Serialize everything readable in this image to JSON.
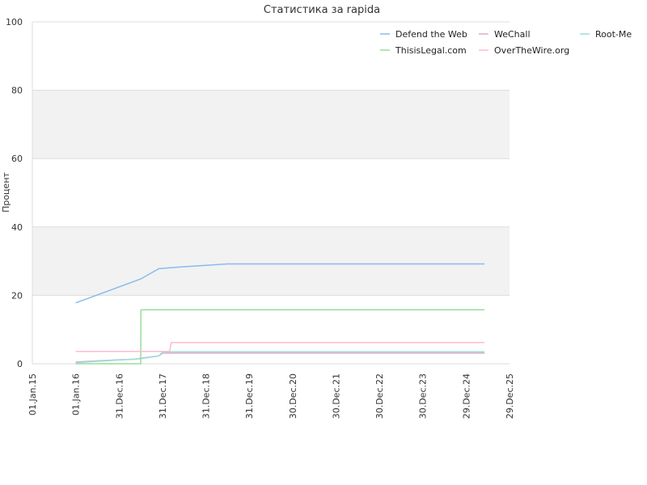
{
  "chart_data": {
    "type": "line",
    "title": "Статистика за rapida",
    "xlabel": "",
    "ylabel": "Процент",
    "ylim": [
      0,
      100
    ],
    "yticks": [
      0,
      20,
      40,
      60,
      80,
      100
    ],
    "xlim": [
      "2015-01-01",
      "2025-12-29"
    ],
    "xticks": [
      {
        "date": "2015-01-01",
        "label": "01.Jan.15"
      },
      {
        "date": "2016-01-01",
        "label": "01.Jan.16"
      },
      {
        "date": "2016-12-31",
        "label": "31.Dec.16"
      },
      {
        "date": "2017-12-31",
        "label": "31.Dec.17"
      },
      {
        "date": "2018-12-31",
        "label": "31.Dec.18"
      },
      {
        "date": "2019-12-31",
        "label": "31.Dec.19"
      },
      {
        "date": "2020-12-30",
        "label": "30.Dec.20"
      },
      {
        "date": "2021-12-30",
        "label": "30.Dec.21"
      },
      {
        "date": "2022-12-30",
        "label": "30.Dec.22"
      },
      {
        "date": "2023-12-30",
        "label": "30.Dec.23"
      },
      {
        "date": "2024-12-29",
        "label": "29.Dec.24"
      },
      {
        "date": "2025-12-29",
        "label": "29.Dec.25"
      }
    ],
    "grid": true,
    "legend_position": "top-right",
    "series": [
      {
        "name": "Defend the Web",
        "color": "#88bbee",
        "points": [
          [
            "2016-01-01",
            17.8
          ],
          [
            "2017-07-01",
            24.8
          ],
          [
            "2017-12-01",
            27.8
          ],
          [
            "2018-06-01",
            28.3
          ],
          [
            "2019-01-01",
            28.8
          ],
          [
            "2019-07-01",
            29.2
          ],
          [
            "2025-06-01",
            29.2
          ]
        ]
      },
      {
        "name": "WeChall",
        "color": "#ddaacc",
        "points": [
          [
            "2016-01-01",
            0.5
          ],
          [
            "2016-06-01",
            0.8
          ],
          [
            "2016-12-01",
            1.1
          ],
          [
            "2017-05-01",
            1.3
          ],
          [
            "2017-07-01",
            1.6
          ],
          [
            "2017-12-01",
            2.3
          ],
          [
            "2018-01-01",
            3.1
          ],
          [
            "2025-06-01",
            3.1
          ]
        ]
      },
      {
        "name": "Root-Me",
        "color": "#99dddd",
        "points": [
          [
            "2016-01-01",
            0.3
          ],
          [
            "2017-07-01",
            1.5
          ],
          [
            "2017-12-01",
            2.3
          ],
          [
            "2018-01-01",
            3.5
          ],
          [
            "2025-06-01",
            3.5
          ]
        ]
      },
      {
        "name": "ThisisLegal.com",
        "color": "#99dd99",
        "points": [
          [
            "2016-01-01",
            0.0
          ],
          [
            "2017-07-01",
            0.0
          ],
          [
            "2017-07-02",
            15.8
          ],
          [
            "2025-06-01",
            15.8
          ]
        ]
      },
      {
        "name": "OverTheWire.org",
        "color": "#ffbbcc",
        "points": [
          [
            "2016-01-01",
            3.6
          ],
          [
            "2018-03-01",
            3.6
          ],
          [
            "2018-03-15",
            6.2
          ],
          [
            "2025-06-01",
            6.2
          ]
        ]
      }
    ]
  }
}
